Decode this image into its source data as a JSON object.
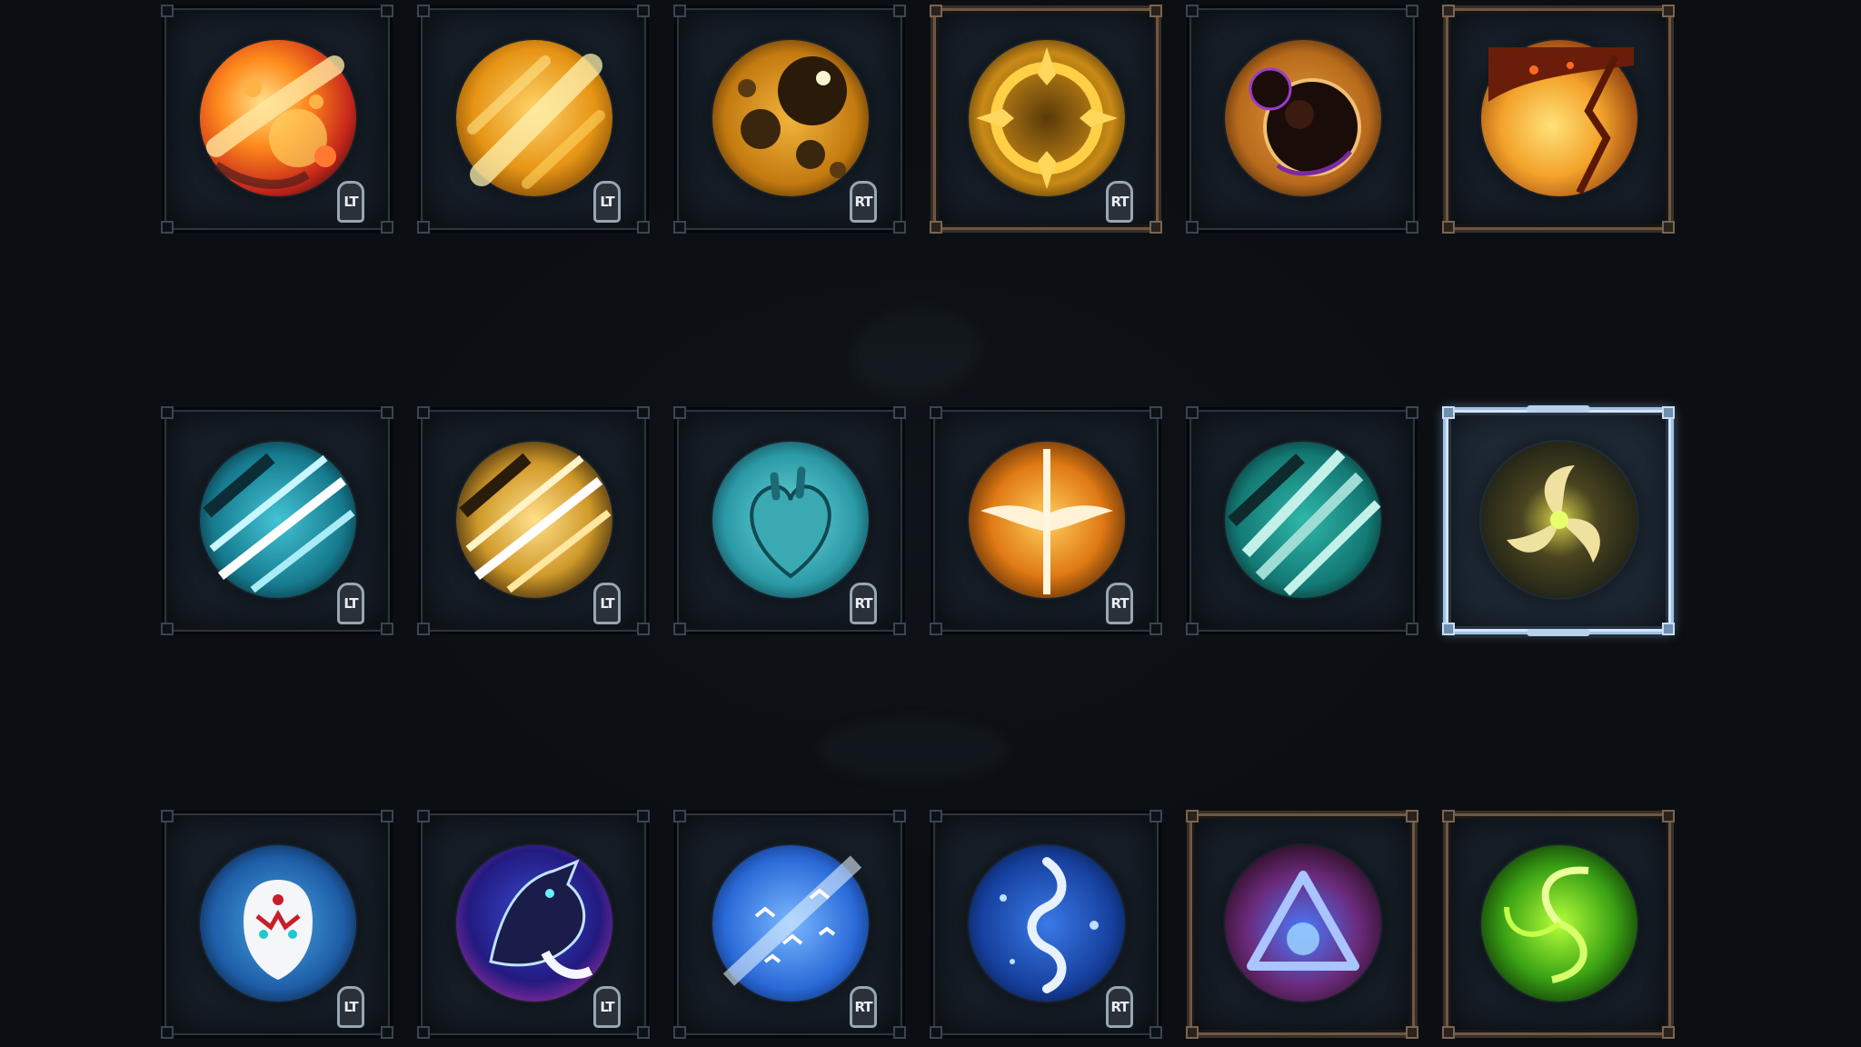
{
  "rows": [
    {
      "slots": [
        {
          "name": "fire-meteor-skill",
          "key": "LT",
          "icon": "fire-meteor-icon"
        },
        {
          "name": "golden-streak-skill",
          "key": "LT",
          "icon": "golden-streak-icon"
        },
        {
          "name": "golden-bubbles-skill",
          "key": "RT",
          "icon": "golden-bubbles-icon"
        },
        {
          "name": "golden-crosshair-skill",
          "key": "RT",
          "icon": "crosshair-icon",
          "frame": "bronze"
        },
        {
          "name": "dark-orb-skill",
          "key": "",
          "icon": "dark-orb-icon"
        },
        {
          "name": "lava-crack-skill",
          "key": "",
          "icon": "lava-crack-icon",
          "frame": "bronze"
        }
      ]
    },
    {
      "slots": [
        {
          "name": "ice-slash-skill",
          "key": "LT",
          "icon": "ice-slash-icon"
        },
        {
          "name": "gold-slash-skill",
          "key": "LT",
          "icon": "gold-slash-icon"
        },
        {
          "name": "frost-heart-skill",
          "key": "RT",
          "icon": "heart-icon"
        },
        {
          "name": "winged-sword-skill",
          "key": "RT",
          "icon": "winged-sword-icon"
        },
        {
          "name": "teal-claw-skill",
          "key": "",
          "icon": "claw-icon"
        },
        {
          "name": "golden-triskelion-skill",
          "key": "",
          "icon": "triskelion-icon",
          "frame": "selected"
        }
      ]
    },
    {
      "slots": [
        {
          "name": "spirit-mask-skill",
          "key": "LT",
          "icon": "spirit-mask-icon"
        },
        {
          "name": "shadow-wolf-skill",
          "key": "LT",
          "icon": "wolf-icon"
        },
        {
          "name": "bird-flock-skill",
          "key": "RT",
          "icon": "birds-icon"
        },
        {
          "name": "serpent-skill",
          "key": "RT",
          "icon": "serpent-icon"
        },
        {
          "name": "arcane-triangle-skill",
          "key": "",
          "icon": "triangle-icon",
          "frame": "bronze"
        },
        {
          "name": "green-vortex-skill",
          "key": "",
          "icon": "vortex-icon",
          "frame": "bronze"
        }
      ]
    }
  ],
  "colors": {
    "background": "#0b0e12",
    "slot_dark": "#18212b",
    "selected_border": "#9fc1e6",
    "bronze_border": "#6b5846",
    "key_tag": "#9aa6b2"
  }
}
